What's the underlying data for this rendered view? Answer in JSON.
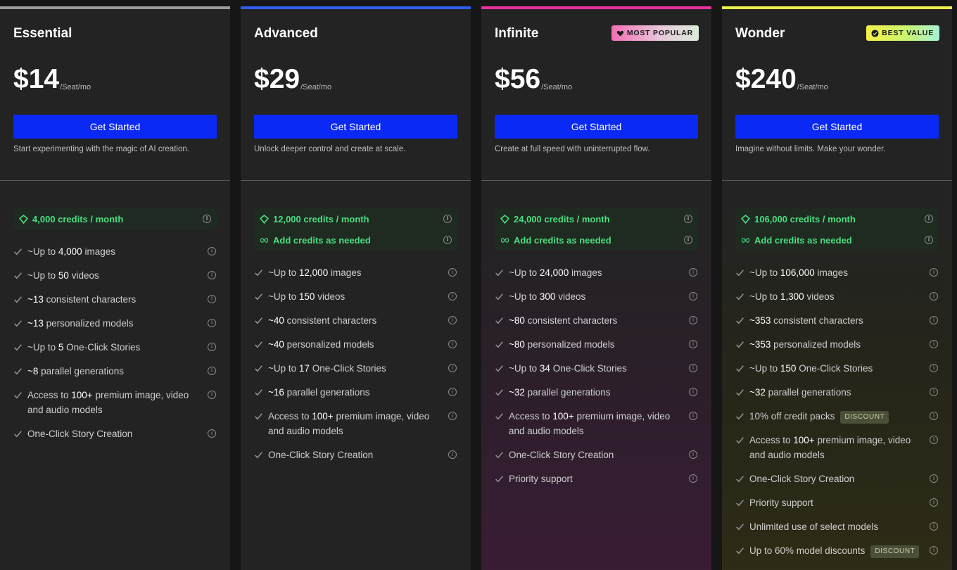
{
  "plans": [
    {
      "name": "Essential",
      "badge": "",
      "price": "$14",
      "per": "/Seat/mo",
      "cta": "Get Started",
      "description": "Start experimenting with the magic of AI creation.",
      "credits": [
        "4,000 credits / month"
      ],
      "features": [
        {
          "pre": "~Up to ",
          "bold": "4,000",
          "post": " images",
          "tag": ""
        },
        {
          "pre": "~Up to ",
          "bold": "50",
          "post": " videos",
          "tag": ""
        },
        {
          "pre": "",
          "bold": "~13",
          "post": " consistent characters",
          "tag": ""
        },
        {
          "pre": "",
          "bold": "~13",
          "post": " personalized models",
          "tag": ""
        },
        {
          "pre": "~Up to ",
          "bold": "5",
          "post": " One-Click Stories",
          "tag": ""
        },
        {
          "pre": "",
          "bold": "~8",
          "post": " parallel generations",
          "tag": ""
        },
        {
          "pre": "Access to ",
          "bold": "100+",
          "post": " premium image, video and audio models",
          "tag": ""
        },
        {
          "pre": "One-Click Story Creation",
          "bold": "",
          "post": "",
          "tag": ""
        }
      ]
    },
    {
      "name": "Advanced",
      "badge": "",
      "price": "$29",
      "per": "/Seat/mo",
      "cta": "Get Started",
      "description": "Unlock deeper control and create at scale.",
      "credits": [
        "12,000 credits / month",
        "Add credits as needed"
      ],
      "features": [
        {
          "pre": "~Up to ",
          "bold": "12,000",
          "post": " images",
          "tag": ""
        },
        {
          "pre": "~Up to ",
          "bold": "150",
          "post": " videos",
          "tag": ""
        },
        {
          "pre": "",
          "bold": "~40",
          "post": " consistent characters",
          "tag": ""
        },
        {
          "pre": "",
          "bold": "~40",
          "post": " personalized models",
          "tag": ""
        },
        {
          "pre": "~Up to ",
          "bold": "17",
          "post": " One-Click Stories",
          "tag": ""
        },
        {
          "pre": "",
          "bold": "~16",
          "post": " parallel generations",
          "tag": ""
        },
        {
          "pre": "Access to ",
          "bold": "100+",
          "post": " premium image, video and audio models",
          "tag": ""
        },
        {
          "pre": "One-Click Story Creation",
          "bold": "",
          "post": "",
          "tag": ""
        }
      ]
    },
    {
      "name": "Infinite",
      "badge": "MOST POPULAR",
      "price": "$56",
      "per": "/Seat/mo",
      "cta": "Get Started",
      "description": "Create at full speed with uninterrupted flow.",
      "credits": [
        "24,000 credits / month",
        "Add credits as needed"
      ],
      "features": [
        {
          "pre": "~Up to ",
          "bold": "24,000",
          "post": " images",
          "tag": ""
        },
        {
          "pre": "~Up to ",
          "bold": "300",
          "post": " videos",
          "tag": ""
        },
        {
          "pre": "",
          "bold": "~80",
          "post": " consistent characters",
          "tag": ""
        },
        {
          "pre": "",
          "bold": "~80",
          "post": " personalized models",
          "tag": ""
        },
        {
          "pre": "~Up to ",
          "bold": "34",
          "post": " One-Click Stories",
          "tag": ""
        },
        {
          "pre": "",
          "bold": "~32",
          "post": " parallel generations",
          "tag": ""
        },
        {
          "pre": "Access to ",
          "bold": "100+",
          "post": " premium image, video and audio models",
          "tag": ""
        },
        {
          "pre": "One-Click Story Creation",
          "bold": "",
          "post": "",
          "tag": ""
        },
        {
          "pre": "Priority support",
          "bold": "",
          "post": "",
          "tag": ""
        }
      ]
    },
    {
      "name": "Wonder",
      "badge": "BEST VALUE",
      "price": "$240",
      "per": "/Seat/mo",
      "cta": "Get Started",
      "description": "Imagine without limits. Make your wonder.",
      "credits": [
        "106,000 credits / month",
        "Add credits as needed"
      ],
      "features": [
        {
          "pre": "~Up to ",
          "bold": "106,000",
          "post": " images",
          "tag": ""
        },
        {
          "pre": "~Up to ",
          "bold": "1,300",
          "post": " videos",
          "tag": ""
        },
        {
          "pre": "",
          "bold": "~353",
          "post": " consistent characters",
          "tag": ""
        },
        {
          "pre": "",
          "bold": "~353",
          "post": " personalized models",
          "tag": ""
        },
        {
          "pre": "~Up to ",
          "bold": "150",
          "post": " One-Click Stories",
          "tag": ""
        },
        {
          "pre": "",
          "bold": "~32",
          "post": " parallel generations",
          "tag": ""
        },
        {
          "pre": "10% off credit packs",
          "bold": "",
          "post": "",
          "tag": "DISCOUNT"
        },
        {
          "pre": "Access to ",
          "bold": "100+",
          "post": " premium image, video and audio models",
          "tag": ""
        },
        {
          "pre": "One-Click Story Creation",
          "bold": "",
          "post": "",
          "tag": ""
        },
        {
          "pre": "Priority support",
          "bold": "",
          "post": "",
          "tag": ""
        },
        {
          "pre": "Unlimited use of select models",
          "bold": "",
          "post": "",
          "tag": ""
        },
        {
          "pre": "Up to 60% model discounts",
          "bold": "",
          "post": "",
          "tag": "DISCOUNT"
        }
      ]
    }
  ],
  "colors": {
    "cta": "#0a29f5",
    "credit_text": "#4ade80",
    "essential_accent": "#9a9a9a",
    "advanced_accent": "#2f5ef0",
    "infinite_accent": "#ec2f9e",
    "wonder_accent": "#eef04a"
  },
  "icons": {
    "credit": "gem-icon",
    "add_credits": "infinity-icon",
    "feature": "check-icon",
    "info": "info-icon",
    "popular": "heart-icon",
    "best": "check-circle-icon"
  }
}
